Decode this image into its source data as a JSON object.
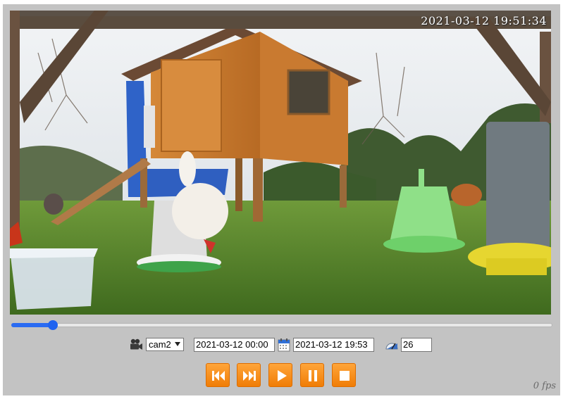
{
  "video": {
    "timestamp": "2021-03-12 19:51:34",
    "playback_position_fraction": 0.077
  },
  "controls": {
    "camera_icon": "video-camera-icon",
    "camera_selected": "cam2",
    "date_from": "2021-03-12 00:00",
    "calendar_icon": "calendar-icon",
    "date_to": "2021-03-12 19:53",
    "speed_icon": "speedometer-icon",
    "fps_value": "26"
  },
  "buttons": [
    {
      "name": "rewind-button",
      "icon": "skip-back-icon"
    },
    {
      "name": "fast-forward-button",
      "icon": "skip-forward-icon"
    },
    {
      "name": "play-button",
      "icon": "play-icon"
    },
    {
      "name": "pause-button",
      "icon": "pause-icon"
    },
    {
      "name": "stop-button",
      "icon": "stop-icon"
    }
  ],
  "status": {
    "fps_label": "0 fps"
  },
  "colors": {
    "panel": "#c3c3c3",
    "accent_orange": "#f7901e",
    "slider_blue": "#1f63f0"
  }
}
